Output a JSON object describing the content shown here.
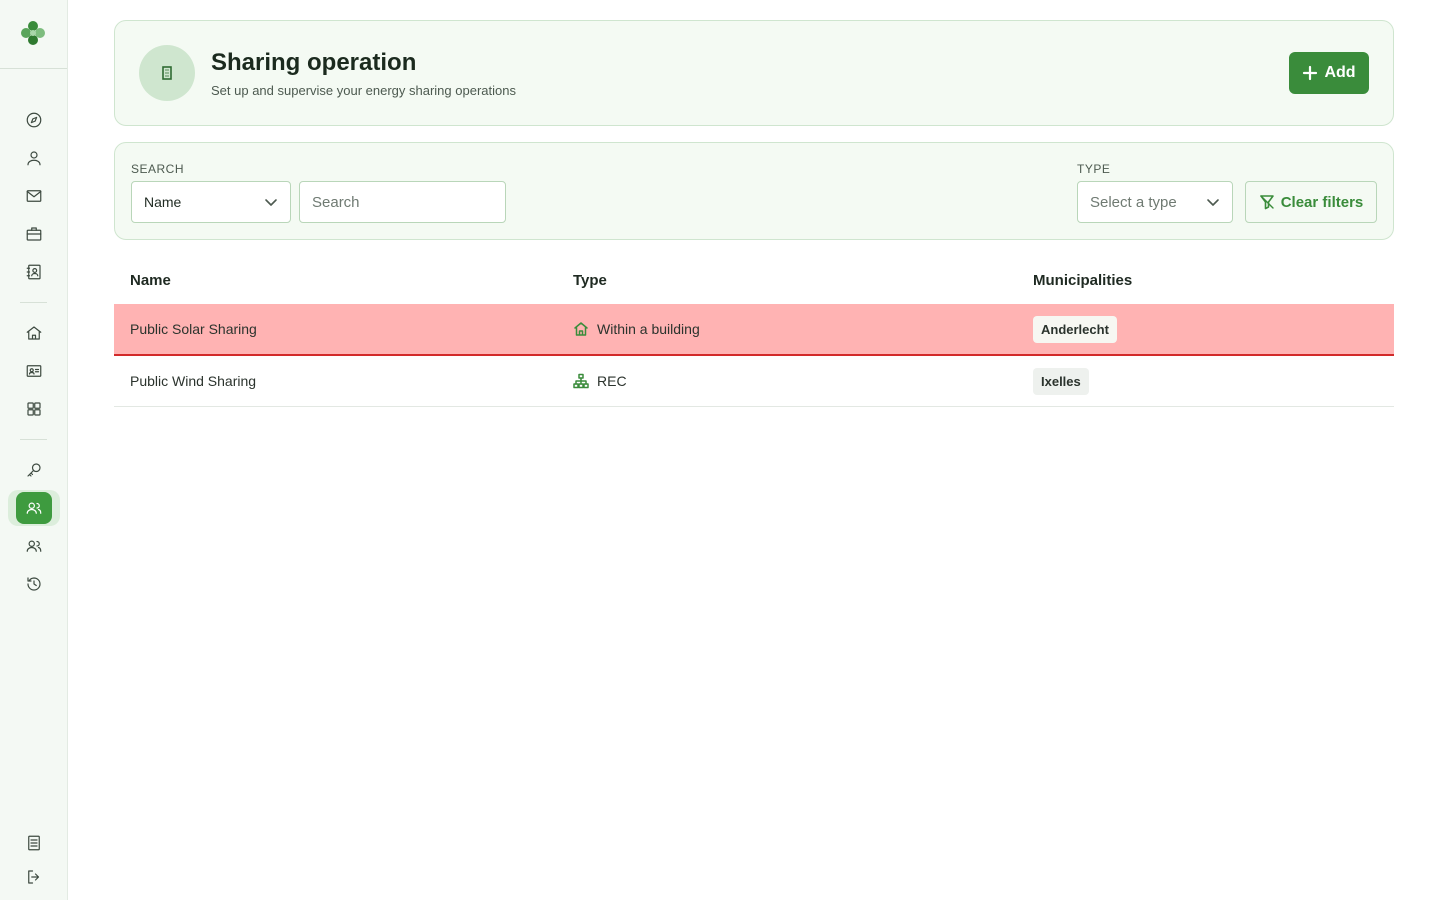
{
  "header": {
    "title": "Sharing operation",
    "subtitle": "Set up and supervise your energy sharing operations",
    "add_label": "Add"
  },
  "filters": {
    "search_label": "SEARCH",
    "search_field_value": "Name",
    "search_placeholder": "Search",
    "type_label": "TYPE",
    "type_placeholder": "Select a type",
    "clear_label": "Clear filters"
  },
  "table": {
    "columns": [
      "Name",
      "Type",
      "Municipalities"
    ],
    "rows": [
      {
        "name": "Public Solar Sharing",
        "type": "Within a building",
        "type_icon": "building-home-icon",
        "municipality": "Anderlecht",
        "highlighted": true
      },
      {
        "name": "Public Wind Sharing",
        "type": "REC",
        "type_icon": "network-icon",
        "municipality": "Ixelles",
        "highlighted": false
      }
    ]
  },
  "sidebar": {
    "items": [
      "compass-icon",
      "user-icon",
      "mail-icon",
      "briefcase-icon",
      "contact-book-icon",
      "home-icon",
      "id-card-icon",
      "grid-icon",
      "key-icon",
      "users-icon",
      "group-icon",
      "history-icon",
      "document-icon",
      "logout-icon"
    ],
    "active_item": "users-icon"
  },
  "colors": {
    "accent": "#3a8c3b",
    "highlight_row": "#ffb3b3",
    "highlight_border": "#d22a2a"
  }
}
